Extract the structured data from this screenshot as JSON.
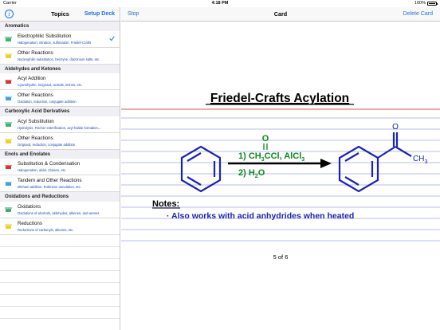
{
  "status_bar": {
    "carrier": "Carrier",
    "time": "4:18 PM",
    "battery": "100%"
  },
  "left_panel": {
    "title": "Topics",
    "setup_label": "Setup Deck",
    "sections": [
      {
        "header": "Aromatics",
        "items": [
          {
            "title": "Electrophilic Substitution",
            "subtitle": "Halogenation, nitration, sulfonation, Friedel-Crafts",
            "tag_color": "#3cb371",
            "selected": true
          },
          {
            "title": "Other Reactions",
            "subtitle": "Nucleophilic substitution, benzyne, diazonium salts, etc.",
            "tag_color": "#f0d020"
          }
        ]
      },
      {
        "header": "Aldehydes and Ketones",
        "items": [
          {
            "title": "Acyl Addition",
            "subtitle": "Cyanohydrin, Grignard, acetals, imines, etc.",
            "tag_color": "#e03030"
          },
          {
            "title": "Other Reactions",
            "subtitle": "Oxidation, reduction, conjugate addition",
            "tag_color": "#40a0e0"
          }
        ]
      },
      {
        "header": "Carboxylic Acid Derivatives",
        "items": [
          {
            "title": "Acyl Substitution",
            "subtitle": "Hydrolysis, Fischer esterification, acyl halide formation,...",
            "tag_color": "#3cb371"
          },
          {
            "title": "Other Reactions",
            "subtitle": "Grignard, reduction, conjugate addition",
            "tag_color": "#f0d020"
          }
        ]
      },
      {
        "header": "Enols and Enolates",
        "items": [
          {
            "title": "Substitution & Condensation",
            "subtitle": "Halogenation, aldol, Claisen, etc.",
            "tag_color": "#e03030"
          },
          {
            "title": "Tandem and Other Reactions",
            "subtitle": "Michael addition, Robinson annulation, etc.",
            "tag_color": "#40a0e0"
          }
        ]
      },
      {
        "header": "Oxidations and Reductions",
        "items": [
          {
            "title": "Oxidations",
            "subtitle": "Oxidations of alcohols, aldehydes, alkenes, and arenes",
            "tag_color": "#3cb371"
          },
          {
            "title": "Reductions",
            "subtitle": "Reductions of carbonyls, alkenes, etc.",
            "tag_color": "#f0d020"
          }
        ]
      }
    ]
  },
  "right_panel": {
    "title": "Card",
    "stop_label": "Stop",
    "delete_label": "Delete Card"
  },
  "card": {
    "heading": "Friedel-Crafts Acylation",
    "reagent_top_oxygen": "O",
    "reagent_step1_prefix": "1) CH",
    "reagent_step1_sub1": "3",
    "reagent_step1_mid": "CCl, AlCl",
    "reagent_step1_sub2": "3",
    "reagent_step2_prefix": "2) H",
    "reagent_step2_sub": "2",
    "reagent_step2_suffix": "O",
    "product_oxygen": "O",
    "product_methyl_prefix": "CH",
    "product_methyl_sub": "3",
    "notes_label": "Notes:",
    "note_1": "· Also works with acid anhydrides when heated",
    "counter": "5 of 6"
  },
  "colors": {
    "accent": "#1a73e8",
    "heading_red_line": "#d02020",
    "ruled_line": "#6f7fe0",
    "structure_blue": "#1b23b5",
    "reagent_green": "#0a8a1a",
    "note_text": "#1b23b5"
  }
}
